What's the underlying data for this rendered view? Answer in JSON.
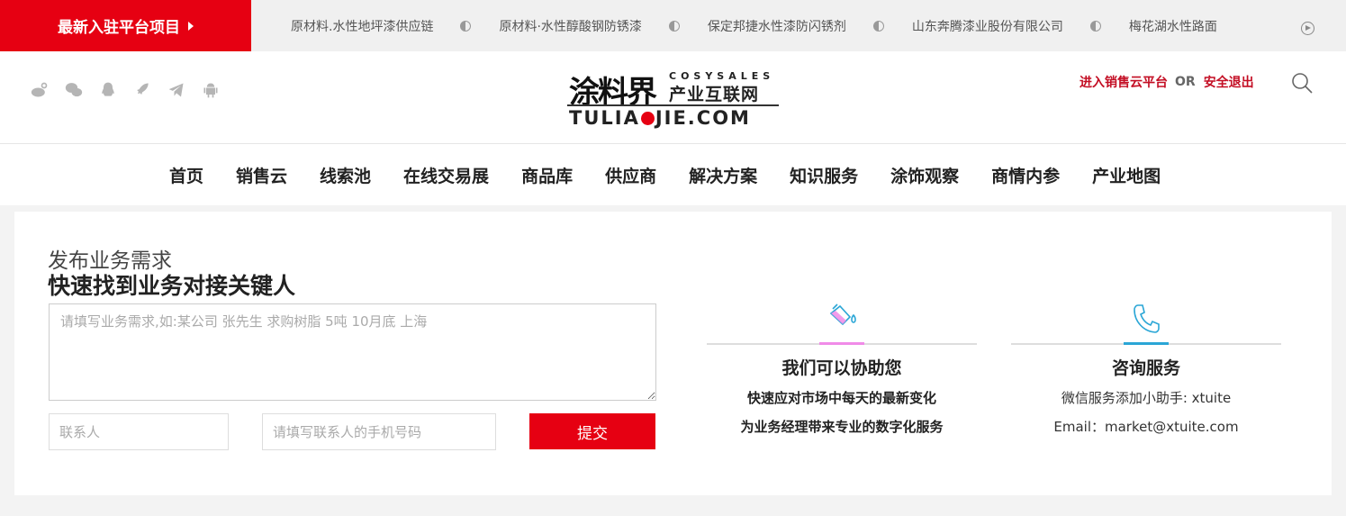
{
  "ticker": {
    "badge": "最新入驻平台项目",
    "items": [
      "原材料.水性地坪漆供应链",
      "原材料·水性醇酸钢防锈漆",
      "保定邦捷水性漆防闪锈剂",
      "山东奔腾漆业股份有限公司",
      "梅花湖水性路面"
    ]
  },
  "header": {
    "social_icons": [
      "weibo-icon",
      "wechat-icon",
      "qq-icon",
      "rocket-icon",
      "telegram-icon",
      "android-icon"
    ],
    "logo": {
      "cn": "涂料界",
      "sub_en": "COSYSALES",
      "sub_cn": "产业互联网",
      "en_left": "TULIA",
      "en_right": "JIE.COM"
    },
    "link_platform": "进入销售云平台",
    "or": "OR",
    "link_logout": "安全退出"
  },
  "nav": {
    "items": [
      "首页",
      "销售云",
      "线索池",
      "在线交易展",
      "商品库",
      "供应商",
      "解决方案",
      "知识服务",
      "涂饰观察",
      "商情内参",
      "产业地图"
    ]
  },
  "form": {
    "subtitle": "发布业务需求",
    "title": "快速找到业务对接关键人",
    "textarea_placeholder": "请填写业务需求,如:某公司 张先生 求购树脂 5吨 10月底 上海",
    "name_placeholder": "联系人",
    "phone_placeholder": "请填写联系人的手机号码",
    "submit": "提交"
  },
  "services": [
    {
      "icon": "paint-bucket-icon",
      "title": "我们可以协助您",
      "lines": [
        "快速应对市场中每天的最新变化",
        "为业务经理带来专业的数字化服务"
      ]
    },
    {
      "icon": "phone-icon",
      "title": "咨询服务",
      "lines": [
        "微信服务添加小助手: xtuite",
        "Email：market@xtuite.com"
      ]
    }
  ],
  "colors": {
    "brand_red": "#e60012",
    "link_red": "#c30d23",
    "accent_pink": "#f08be8",
    "accent_blue": "#2aa6d6"
  }
}
